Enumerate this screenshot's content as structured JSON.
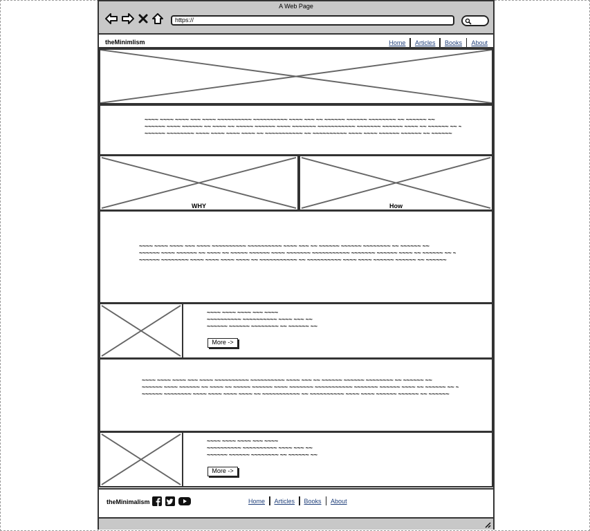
{
  "window": {
    "title": "A Web Page"
  },
  "addressbar": {
    "url": "https://"
  },
  "site": {
    "brand": "theMinimlism",
    "nav": [
      "Home",
      "Articles",
      "Books",
      "About"
    ]
  },
  "intro": {
    "lines": [
      "~~~~ ~~~~ ~~~~ ~~~ ~~~~ ~~~~~~~~~~ ~~~~~~~~~~ ~~~~ ~~~ ~~ ~~~~~~ ~~~~~~ ~~~~~~~~ ~~ ~~~~~~ ~~",
      "~~~~~~ ~~~~ ~~~~~~ ~~ ~~~~ ~~ ~~~~~ ~~~~~~ ~~~~ ~~~~~~~ ~~~~~~~~~~~ ~~~~~~~ ~~~~~~ ~~~~ ~~ ~~~~~~ ~~ ~~",
      "~~~~~~ ~~~~~~~~ ~~~~ ~~~~ ~~~~ ~~~~ ~~ ~~~~~~~~~~~ ~~ ~~~~~~~~~~ ~~~~ ~~~~ ~~~~~~ ~~~~~~ ~~ ~~~~~~"
    ]
  },
  "pair": {
    "left_caption": "WHY",
    "right_caption": "How"
  },
  "section2": {
    "lines": [
      "~~~~ ~~~~ ~~~~ ~~~ ~~~~ ~~~~~~~~~~ ~~~~~~~~~~ ~~~~ ~~~ ~~ ~~~~~~ ~~~~~~ ~~~~~~~~ ~~ ~~~~~~ ~~",
      "~~~~~~ ~~~~ ~~~~~~ ~~ ~~~~ ~~ ~~~~~ ~~~~~~ ~~~~ ~~~~~~~ ~~~~~~~~~~~ ~~~~~~~ ~~~~~~ ~~~~ ~~ ~~~~~~ ~~ ~~",
      "~~~~~~ ~~~~~~~~ ~~~~ ~~~~ ~~~~ ~~~~ ~~ ~~~~~~~~~~~ ~~ ~~~~~~~~~~ ~~~~ ~~~~ ~~~~~~ ~~~~~~ ~~ ~~~~~~"
    ]
  },
  "card1": {
    "lines": [
      "~~~~ ~~~~ ~~~~ ~~~ ~~~~",
      "~~~~~~~~~~ ~~~~~~~~~~ ~~~~ ~~~ ~~",
      "~~~~~~ ~~~~~~ ~~~~~~~~ ~~ ~~~~~~ ~~"
    ],
    "button": "More ->"
  },
  "section3": {
    "lines": [
      "~~~~ ~~~~ ~~~~ ~~~ ~~~~ ~~~~~~~~~~ ~~~~~~~~~~ ~~~~ ~~~ ~~ ~~~~~~ ~~~~~~ ~~~~~~~~ ~~ ~~~~~~ ~~",
      "~~~~~~ ~~~~ ~~~~~~ ~~ ~~~~ ~~ ~~~~~ ~~~~~~ ~~~~ ~~~~~~~ ~~~~~~~~~~~ ~~~~~~~ ~~~~~~ ~~~~ ~~ ~~~~~~ ~~ ~~",
      "~~~~~~ ~~~~~~~~ ~~~~ ~~~~ ~~~~ ~~~~ ~~ ~~~~~~~~~~~ ~~ ~~~~~~~~~~ ~~~~ ~~~~ ~~~~~~ ~~~~~~ ~~ ~~~~~~"
    ]
  },
  "card2": {
    "lines": [
      "~~~~ ~~~~ ~~~~ ~~~ ~~~~",
      "~~~~~~~~~~ ~~~~~~~~~~ ~~~~ ~~~ ~~",
      "~~~~~~ ~~~~~~ ~~~~~~~~ ~~ ~~~~~~ ~~"
    ],
    "button": "More ->"
  },
  "footer": {
    "brand": "theMinimalism",
    "social_icons": [
      "facebook-icon",
      "twitter-icon",
      "youtube-icon"
    ],
    "nav": [
      "Home",
      "Articles",
      "Books",
      "About"
    ]
  }
}
